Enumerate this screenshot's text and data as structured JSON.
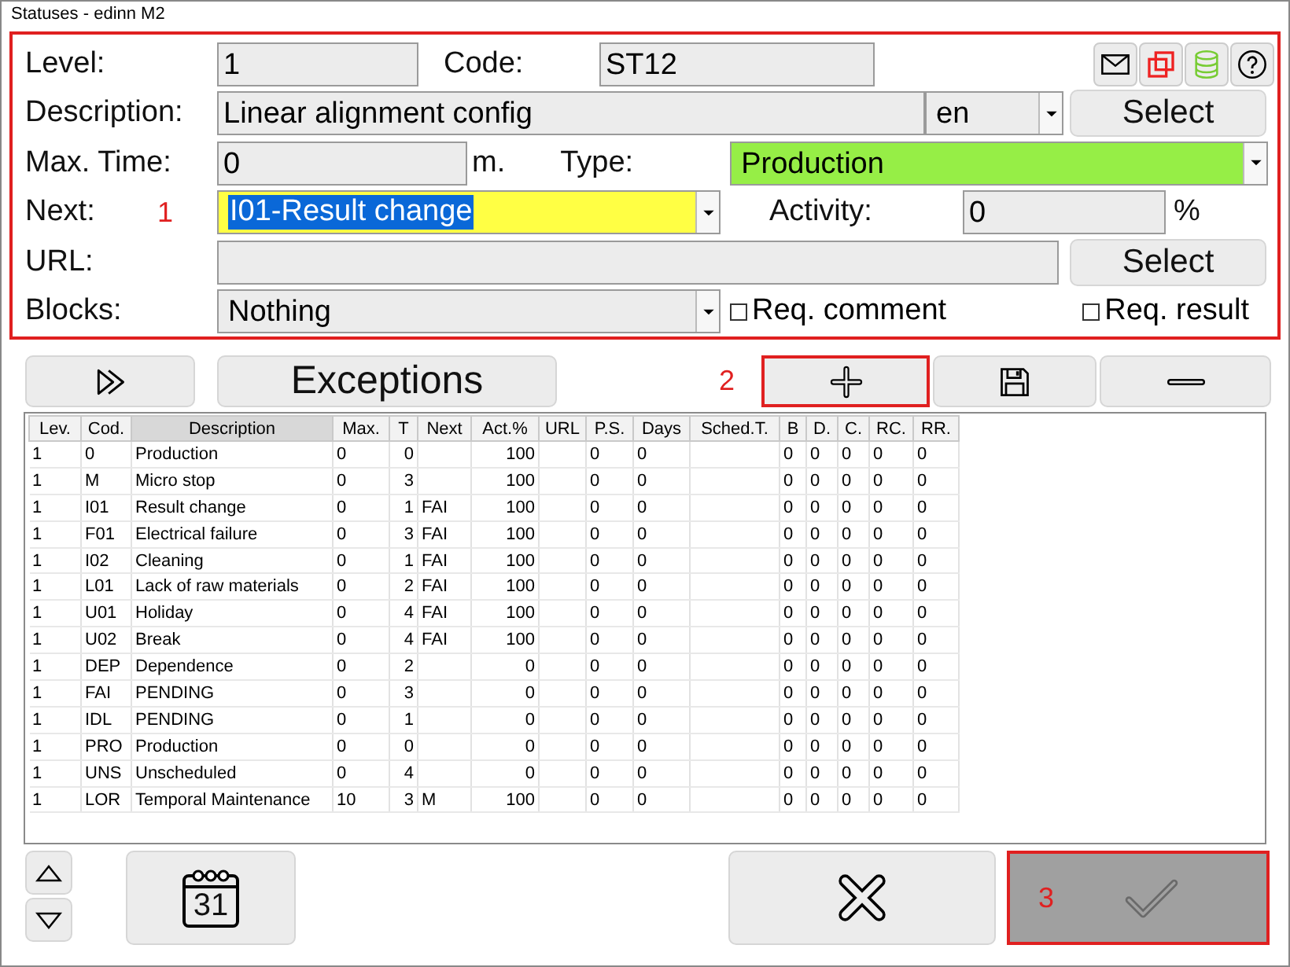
{
  "window": {
    "title": "Statuses - edinn M2"
  },
  "form": {
    "level": {
      "label": "Level:",
      "value": "1"
    },
    "code": {
      "label": "Code:",
      "value": "ST12"
    },
    "description": {
      "label": "Description:",
      "value": "Linear alignment config",
      "language": "en",
      "button": "Select"
    },
    "max_time": {
      "label": "Max. Time:",
      "value": "0",
      "unit": "m."
    },
    "type": {
      "label": "Type:",
      "value": "Production",
      "color": "#96ee46"
    },
    "next": {
      "label": "Next:",
      "marker": "1",
      "value": "I01-Result change",
      "color": "#ffff44",
      "text_selected": true
    },
    "activity": {
      "label": "Activity:",
      "value": "0",
      "unit": "%"
    },
    "url": {
      "label": "URL:",
      "button": "Select"
    },
    "blocks": {
      "label": "Blocks:",
      "value": "Nothing"
    },
    "options": [
      {
        "label": "Req. comment",
        "checked": false
      },
      {
        "label": "Req. result",
        "checked": false
      }
    ]
  },
  "toolbar": {
    "title": "Exceptions",
    "marker": "2"
  },
  "table": {
    "columns": [
      {
        "label": "Lev.",
        "selected": false
      },
      {
        "label": "Cod.",
        "selected": false
      },
      {
        "label": "Description",
        "selected": true
      },
      {
        "label": "Max.",
        "selected": false
      },
      {
        "label": "T",
        "selected": false
      },
      {
        "label": "Next",
        "selected": false
      },
      {
        "label": "Act.%",
        "selected": false
      },
      {
        "label": "URL",
        "selected": false
      },
      {
        "label": "P.S.",
        "selected": false
      },
      {
        "label": "Days",
        "selected": false
      },
      {
        "label": "Sched.T.",
        "selected": false
      },
      {
        "label": "B",
        "selected": false
      },
      {
        "label": "D.",
        "selected": false
      },
      {
        "label": "C.",
        "selected": false
      },
      {
        "label": "RC.",
        "selected": false
      },
      {
        "label": "RR.",
        "selected": false
      }
    ],
    "rows": [
      [
        "1",
        "0",
        "Production",
        "0",
        "0",
        "",
        "100",
        "",
        "0",
        "0",
        "",
        "0",
        "0",
        "0",
        "0",
        "0"
      ],
      [
        "1",
        "M",
        "Micro stop",
        "0",
        "3",
        "",
        "100",
        "",
        "0",
        "0",
        "",
        "0",
        "0",
        "0",
        "0",
        "0"
      ],
      [
        "1",
        "I01",
        "Result change",
        "0",
        "1",
        "FAI",
        "100",
        "",
        "0",
        "0",
        "",
        "0",
        "0",
        "0",
        "0",
        "0"
      ],
      [
        "1",
        "F01",
        "Electrical failure",
        "0",
        "3",
        "FAI",
        "100",
        "",
        "0",
        "0",
        "",
        "0",
        "0",
        "0",
        "0",
        "0"
      ],
      [
        "1",
        "I02",
        "Cleaning",
        "0",
        "1",
        "FAI",
        "100",
        "",
        "0",
        "0",
        "",
        "0",
        "0",
        "0",
        "0",
        "0"
      ],
      [
        "1",
        "L01",
        "Lack of raw materials",
        "0",
        "2",
        "FAI",
        "100",
        "",
        "0",
        "0",
        "",
        "0",
        "0",
        "0",
        "0",
        "0"
      ],
      [
        "1",
        "U01",
        "Holiday",
        "0",
        "4",
        "FAI",
        "100",
        "",
        "0",
        "0",
        "",
        "0",
        "0",
        "0",
        "0",
        "0"
      ],
      [
        "1",
        "U02",
        "Break",
        "0",
        "4",
        "FAI",
        "100",
        "",
        "0",
        "0",
        "",
        "0",
        "0",
        "0",
        "0",
        "0"
      ],
      [
        "1",
        "DEP",
        "Dependence",
        "0",
        "2",
        "",
        "0",
        "",
        "0",
        "0",
        "",
        "0",
        "0",
        "0",
        "0",
        "0"
      ],
      [
        "1",
        "FAI",
        "PENDING",
        "0",
        "3",
        "",
        "0",
        "",
        "0",
        "0",
        "",
        "0",
        "0",
        "0",
        "0",
        "0"
      ],
      [
        "1",
        "IDL",
        "PENDING",
        "0",
        "1",
        "",
        "0",
        "",
        "0",
        "0",
        "",
        "0",
        "0",
        "0",
        "0",
        "0"
      ],
      [
        "1",
        "PRO",
        "Production",
        "0",
        "0",
        "",
        "0",
        "",
        "0",
        "0",
        "",
        "0",
        "0",
        "0",
        "0",
        "0"
      ],
      [
        "1",
        "UNS",
        "Unscheduled",
        "0",
        "4",
        "",
        "0",
        "",
        "0",
        "0",
        "",
        "0",
        "0",
        "0",
        "0",
        "0"
      ],
      [
        "1",
        "LOR",
        "Temporal Maintenance",
        "10",
        "3",
        "M",
        "100",
        "",
        "0",
        "0",
        "",
        "0",
        "0",
        "0",
        "0",
        "0"
      ]
    ]
  },
  "footer": {
    "calendar_day": "31",
    "marker": "3",
    "accept_disabled": true
  }
}
